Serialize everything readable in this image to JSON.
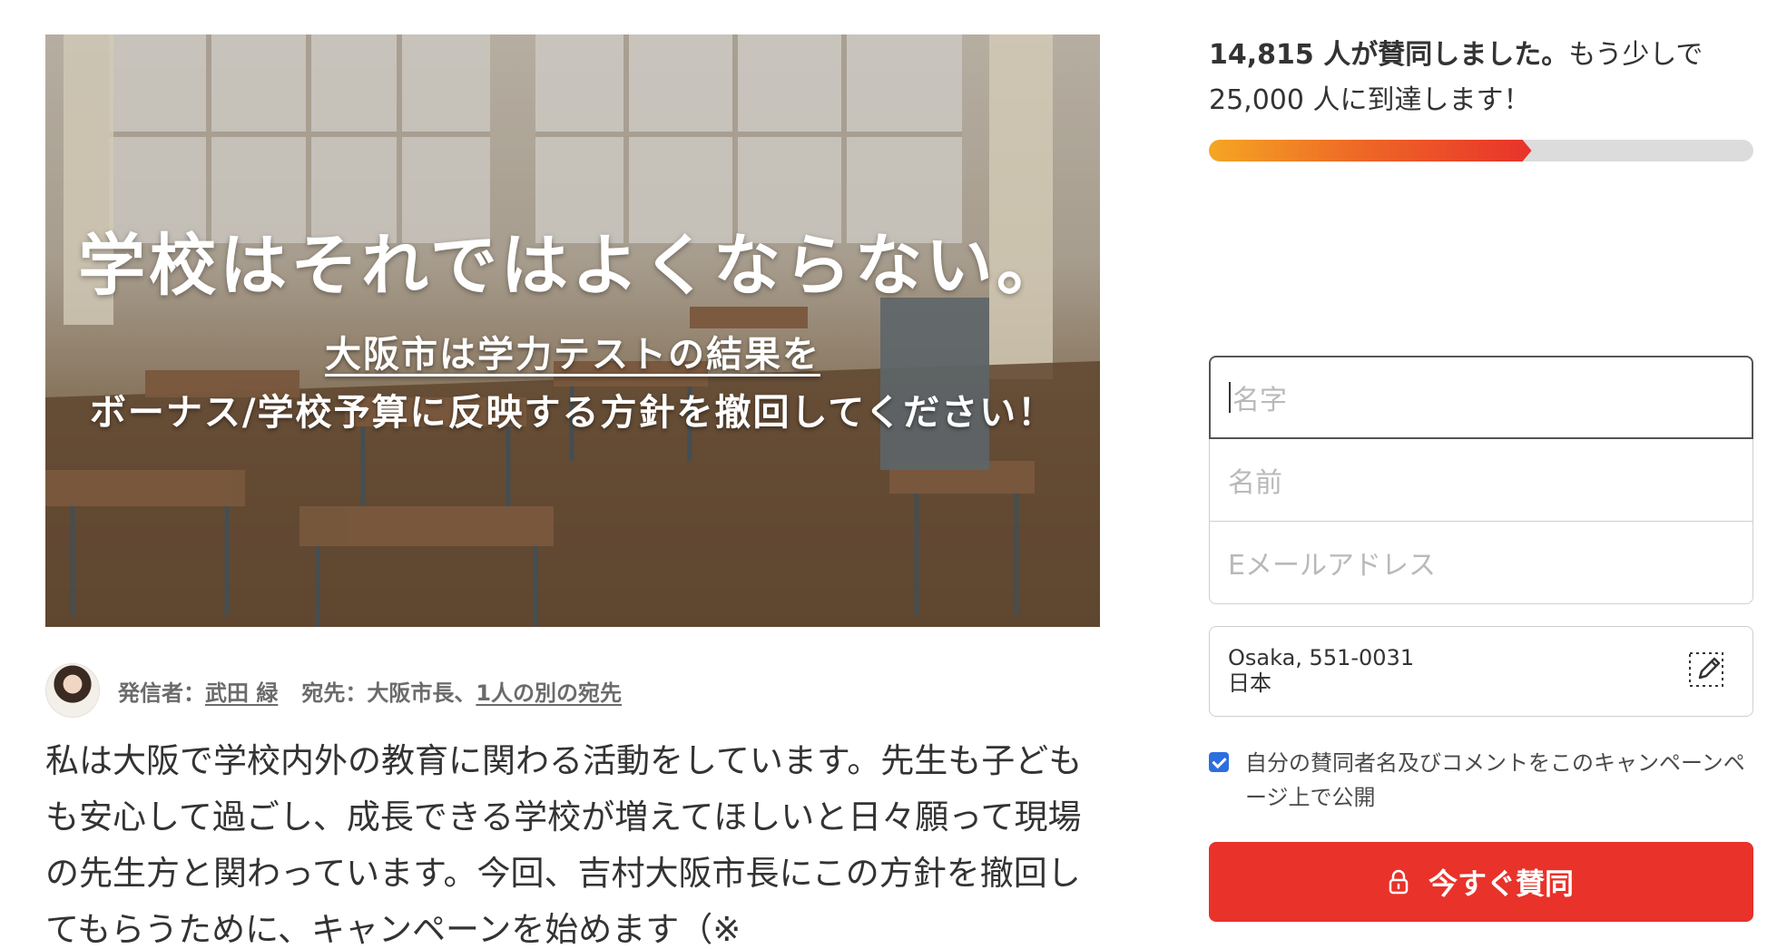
{
  "hero": {
    "title": "学校はそれではよくならない。",
    "line1": "大阪市は学力テストの結果を",
    "line2": "ボーナス/学校予算に反映する方針を撤回してください！"
  },
  "byline": {
    "starter_label": "発信者：",
    "starter_name": "武田 緑",
    "target_label": "宛先：大阪市長、",
    "target_link": "1人の別の宛先"
  },
  "description": "私は大阪で学校内外の教育に関わる活動をしています。先生も子どもも安心して過ごし、成長できる学校が増えてほしいと日々願って現場の先生方と関わっています。今回、吉村大阪市長にこの方針を撤回してもらうために、キャンペーンを始めます（※",
  "progress": {
    "count_text": "14,815 人が賛同しました。",
    "rest_text": "もう少しで 25,000 人に到達します！",
    "signatures": 14815,
    "goal": 25000,
    "fill_fraction": 0.5926
  },
  "form": {
    "last_name_placeholder": "名字",
    "first_name_placeholder": "名前",
    "email_placeholder": "Eメールアドレス",
    "location_line1": "Osaka, 551-0031",
    "location_line2": "日本",
    "consent_text": "自分の賛同者名及びコメントをこのキャンペーンページ上で公開",
    "consent_checked": true,
    "sign_button": "今すぐ賛同"
  },
  "colors": {
    "accent": "#e8322a",
    "progress_start": "#f5a623",
    "checkbox": "#2b6fdf"
  }
}
